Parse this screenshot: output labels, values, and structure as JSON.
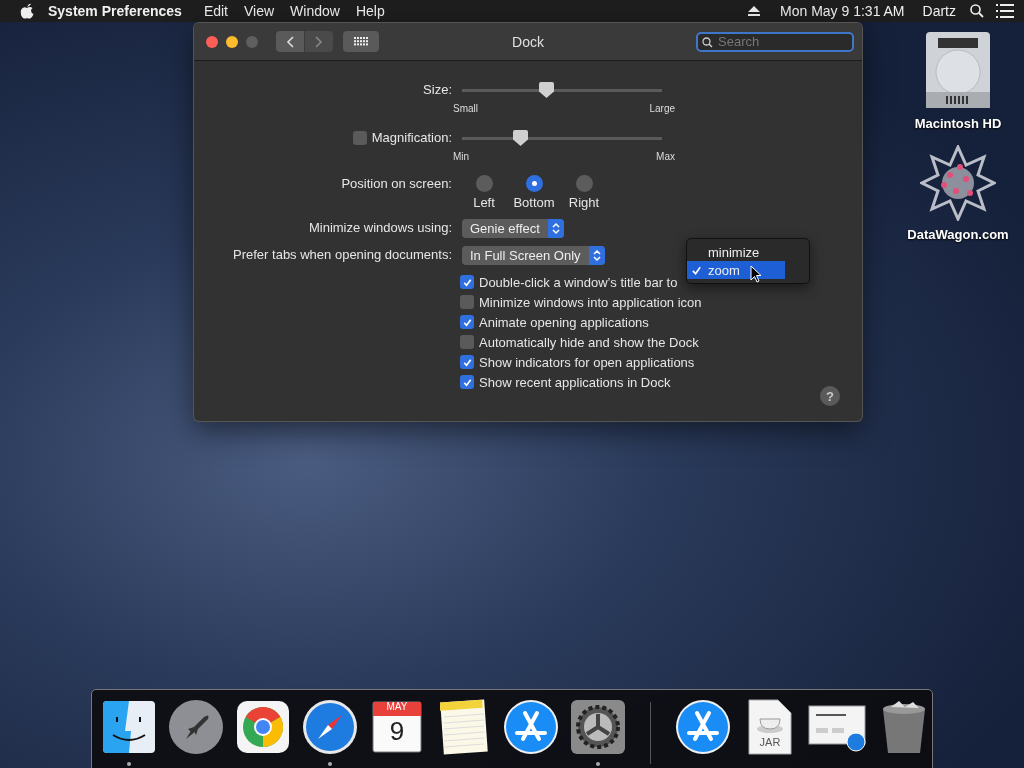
{
  "menu_bar": {
    "app_name": "System Preferences",
    "menus": [
      "Edit",
      "View",
      "Window",
      "Help"
    ],
    "clock": "Mon May 9  1:31 AM",
    "user": "Dartz"
  },
  "window": {
    "title": "Dock",
    "search": {
      "placeholder": "Search"
    },
    "size": {
      "label": "Size:",
      "level": 0.42,
      "min_label": "Small",
      "max_label": "Large"
    },
    "magnification": {
      "label": "Magnification:",
      "checked": false,
      "level": 0.29,
      "min_label": "Min",
      "max_label": "Max"
    },
    "position": {
      "label": "Position on screen:",
      "options": [
        {
          "label": "Left",
          "selected": false
        },
        {
          "label": "Bottom",
          "selected": true
        },
        {
          "label": "Right",
          "selected": false
        }
      ]
    },
    "minimize_using": {
      "label": "Minimize windows using:",
      "value": "Genie effect"
    },
    "prefer_tabs": {
      "label": "Prefer tabs when opening documents:",
      "value": "In Full Screen Only"
    },
    "checkboxes": [
      {
        "label": "Double-click a window’s title bar to",
        "checked": true
      },
      {
        "label": "Minimize windows into application icon",
        "checked": false
      },
      {
        "label": "Animate opening applications",
        "checked": true
      },
      {
        "label": "Automatically hide and show the Dock",
        "checked": false
      },
      {
        "label": "Show indicators for open applications",
        "checked": true
      },
      {
        "label": "Show recent applications in Dock",
        "checked": true
      }
    ],
    "popup_menu": [
      {
        "label": "minimize",
        "selected": false
      },
      {
        "label": "zoom",
        "selected": true
      }
    ],
    "help_button": "?"
  },
  "desktop_icons": [
    {
      "kind": "drive",
      "label": "Macintosh HD"
    },
    {
      "kind": "star",
      "label": "DataWagon.com"
    }
  ],
  "dock": {
    "items": [
      {
        "kind": "finder",
        "running": true
      },
      {
        "kind": "launchpad",
        "running": false
      },
      {
        "kind": "chrome",
        "running": false
      },
      {
        "kind": "safari",
        "running": true
      },
      {
        "kind": "calendar",
        "running": false,
        "month": "MAY",
        "day": "9"
      },
      {
        "kind": "notes",
        "running": false
      },
      {
        "kind": "appstore",
        "running": false
      },
      {
        "kind": "settings",
        "running": true
      },
      {
        "kind": "separator"
      },
      {
        "kind": "appstore",
        "running": false
      },
      {
        "kind": "jar",
        "running": false,
        "caption": "JAR"
      },
      {
        "kind": "window",
        "running": false
      },
      {
        "kind": "trash",
        "running": false
      }
    ]
  }
}
